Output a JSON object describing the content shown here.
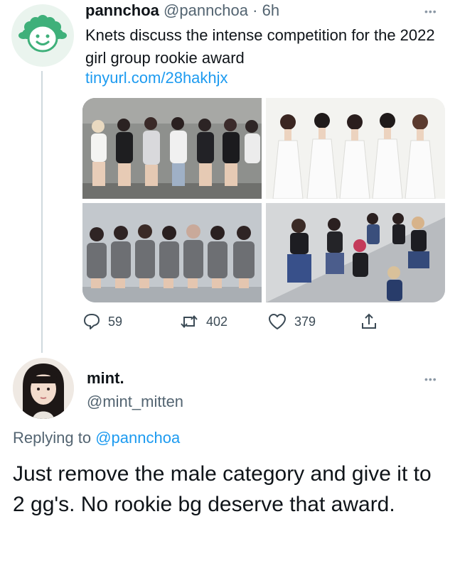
{
  "tweet": {
    "author_name": "pannchoa",
    "author_handle": "@pannchoa",
    "separator": "·",
    "time": "6h",
    "text": "Knets discuss the intense competition for the 2022 girl group rookie award",
    "link": "tinyurl.com/28hakhjx",
    "more_label": "•••",
    "replies": "59",
    "retweets": "402",
    "likes": "379"
  },
  "reply": {
    "author_name": "mint.",
    "author_handle": "@mint_mitten",
    "more_label": "•••",
    "replying_prefix": "Replying to",
    "replying_to": "@pannchoa",
    "text": "Just remove the male category and give it to 2 gg's. No rookie bg deserve that award."
  },
  "icons": {
    "reply": "speech-bubble-icon",
    "retweet": "retweet-arrows-icon",
    "like": "heart-icon",
    "share": "share-upload-icon"
  },
  "colors": {
    "link": "#1d9bf0",
    "secondary_text": "#536471",
    "avatar_green": "#3fb07a"
  }
}
